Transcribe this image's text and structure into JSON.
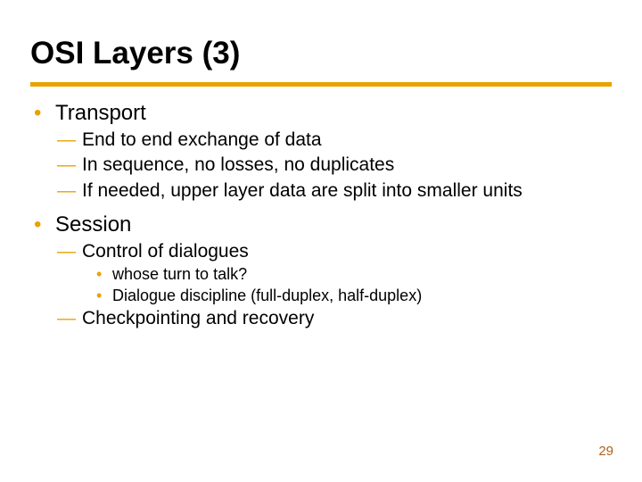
{
  "title": "OSI Layers (3)",
  "bullets": {
    "b0": "Transport",
    "b0_0": "End to end exchange of data",
    "b0_1": "In sequence, no losses, no duplicates",
    "b0_2": "If needed, upper layer data are split into smaller units",
    "b1": "Session",
    "b1_0": "Control of dialogues",
    "b1_0_0": "whose turn to talk?",
    "b1_0_1": "Dialogue discipline (full-duplex, half-duplex)",
    "b1_1": "Checkpointing and recovery"
  },
  "page_number": "29"
}
